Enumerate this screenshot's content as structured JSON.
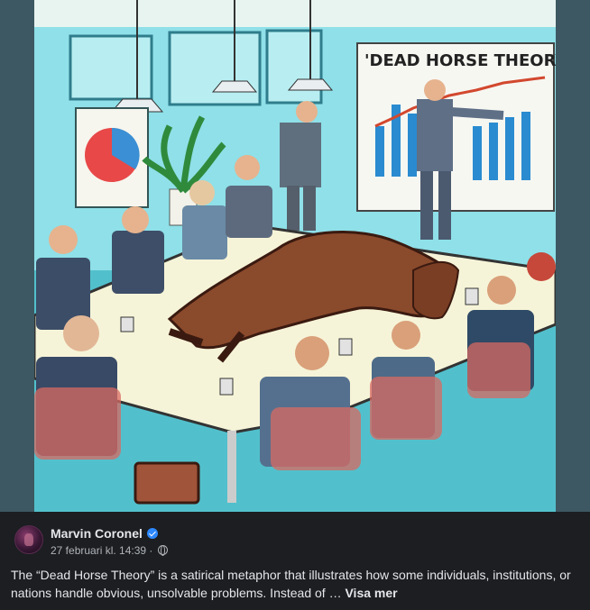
{
  "post": {
    "image": {
      "chart_title": "'DEAD HORSE THEORY",
      "description_icon": "meeting-illustration"
    },
    "author": {
      "name": "Marvin Coronel",
      "verified": true,
      "avatar": "avatar-icon"
    },
    "timestamp": "27 februari kl. 14:39",
    "separator": "·",
    "audience_icon": "globe-icon",
    "caption_text": "The “Dead Horse Theory” is a satirical metaphor that illustrates how some individuals, institutions, or nations handle obvious, unsolvable problems. Instead of …",
    "see_more_label": "Visa mer"
  },
  "colors": {
    "panel_bg": "#1c1e21",
    "text_primary": "#e4e6eb",
    "text_secondary": "#b0b3b8",
    "verified_blue": "#2d88ff"
  }
}
